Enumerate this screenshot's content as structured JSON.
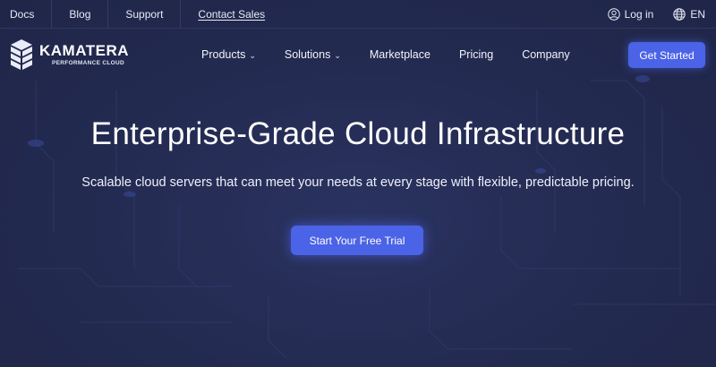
{
  "topbar": {
    "links": [
      "Docs",
      "Blog",
      "Support",
      "Contact Sales"
    ],
    "login_label": "Log in",
    "language": "EN"
  },
  "nav": {
    "logo_name": "KAMATERA",
    "logo_tagline": "PERFORMANCE CLOUD",
    "items": [
      {
        "label": "Products",
        "dropdown": true
      },
      {
        "label": "Solutions",
        "dropdown": true
      },
      {
        "label": "Marketplace",
        "dropdown": false
      },
      {
        "label": "Pricing",
        "dropdown": false
      },
      {
        "label": "Company",
        "dropdown": false
      }
    ],
    "cta_label": "Get Started"
  },
  "hero": {
    "title": "Enterprise-Grade Cloud Infrastructure",
    "subtitle": "Scalable cloud servers that can meet your needs at every stage with flexible, predictable pricing.",
    "cta_label": "Start Your Free Trial"
  },
  "icons": {
    "user": "user-icon",
    "globe": "globe-icon",
    "chevron": "chevron-down-icon",
    "logo": "kamatera-logo-icon"
  },
  "colors": {
    "background": "#242c52",
    "accent": "#4b63e6",
    "text": "#ffffff"
  }
}
